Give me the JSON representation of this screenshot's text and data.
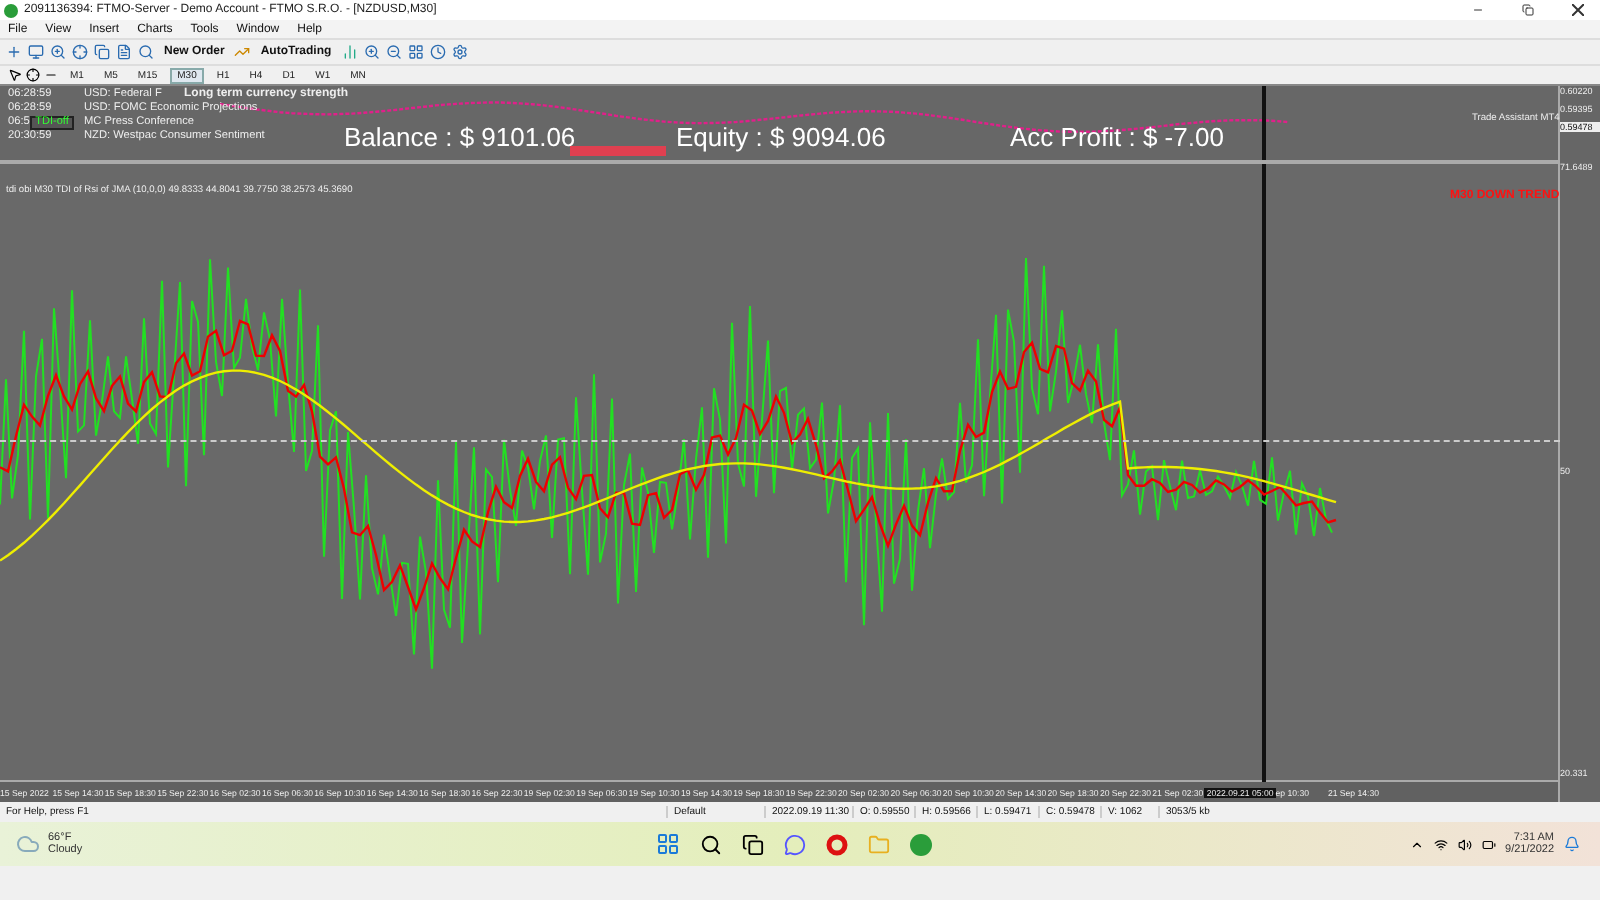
{
  "window": {
    "title": "2091136394: FTMO-Server - Demo Account - FTMO S.R.O. - [NZDUSD,M30]"
  },
  "menu": [
    "File",
    "View",
    "Insert",
    "Charts",
    "Tools",
    "Window",
    "Help"
  ],
  "toolbar": {
    "new_order": "New Order",
    "auto_trading": "AutoTrading"
  },
  "timeframes": [
    {
      "label": "M1",
      "selected": false
    },
    {
      "label": "M5",
      "selected": false
    },
    {
      "label": "M15",
      "selected": false
    },
    {
      "label": "M30",
      "selected": true
    },
    {
      "label": "H1",
      "selected": false
    },
    {
      "label": "H4",
      "selected": false
    },
    {
      "label": "D1",
      "selected": false
    },
    {
      "label": "W1",
      "selected": false
    },
    {
      "label": "MN",
      "selected": false
    }
  ],
  "news": [
    {
      "time": "06:28:59",
      "text": "USD: Federal F"
    },
    {
      "time": "06:28:59",
      "text": "USD: FOMC Economic Projections"
    },
    {
      "time": "06:5",
      "text": "MC Press Conference"
    },
    {
      "time": "20:30:59",
      "text": "NZD: Westpac Consumer Sentiment"
    }
  ],
  "strength_title": "Long term currency strength",
  "tdi_button": "TDI-off",
  "account": {
    "balance": "Balance : $ 9101.06",
    "equity": "Equity : $ 9094.06",
    "profit": "Acc Profit : $ -7.00"
  },
  "trade_assistant": "Trade Assistant MT4",
  "price_axis": [
    "0.60220",
    "0.59395",
    "0.59478"
  ],
  "indicator": {
    "label": "tdi obi M30 TDI of Rsi of JMA (10,0,0) 49.8333 44.8041 39.7750 38.2573 45.3690",
    "trend": "M30 DOWN TREND",
    "axis": [
      "71.6489",
      "50",
      "20.331"
    ]
  },
  "time_axis": [
    "15 Sep 2022",
    "15 Sep 14:30",
    "15 Sep 18:30",
    "15 Sep 22:30",
    "16 Sep 02:30",
    "16 Sep 06:30",
    "16 Sep 10:30",
    "16 Sep 14:30",
    "16 Sep 18:30",
    "16 Sep 22:30",
    "19 Sep 02:30",
    "19 Sep 06:30",
    "19 Sep 10:30",
    "19 Sep 14:30",
    "19 Sep 18:30",
    "19 Sep 22:30",
    "20 Sep 02:30",
    "20 Sep 06:30",
    "20 Sep 10:30",
    "20 Sep 14:30",
    "20 Sep 18:30",
    "20 Sep 22:30",
    "21 Sep 02:30"
  ],
  "cursor_time": "2022.09.21 05:00",
  "time_axis_tail": [
    "ep 10:30",
    "21 Sep 14:30"
  ],
  "status_bar": {
    "help": "For Help, press F1",
    "profile": "Default",
    "bar_time": "2022.09.19 11:30",
    "open": "O: 0.59550",
    "high": "H: 0.59566",
    "low": "L: 0.59471",
    "close": "C: 0.59478",
    "volume": "V: 1062",
    "traffic": "3053/5 kb"
  },
  "taskbar": {
    "temperature": "66°F",
    "weather": "Cloudy",
    "time": "7:31 AM",
    "date": "9/21/2022"
  }
}
